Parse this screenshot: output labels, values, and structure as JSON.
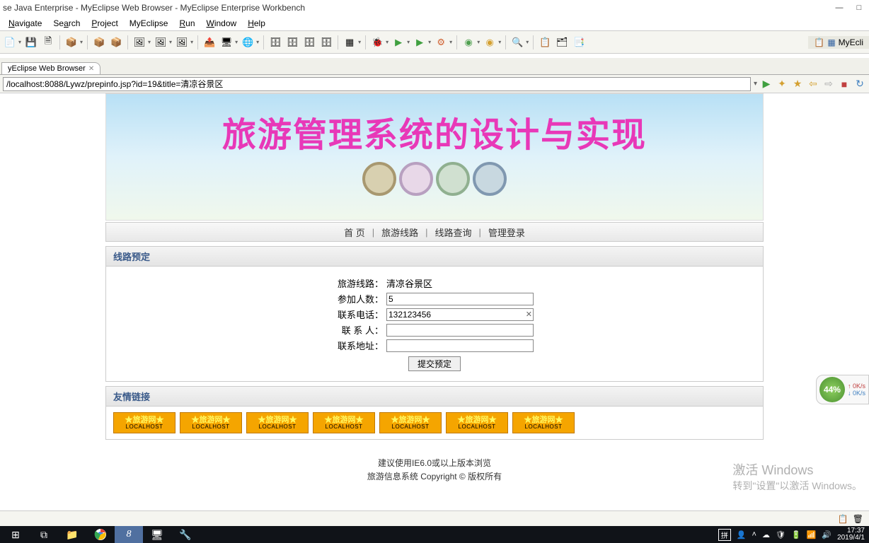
{
  "window": {
    "title": "se Java Enterprise - MyEclipse Web Browser - MyEclipse Enterprise Workbench"
  },
  "menu": {
    "navigate": "Navigate",
    "search": "Search",
    "project": "Project",
    "myeclipse": "MyEclipse",
    "run": "Run",
    "window": "Window",
    "help": "Help"
  },
  "perspective": {
    "label": "MyEcli"
  },
  "tab": {
    "label": "yEclipse Web Browser"
  },
  "url": {
    "value": "/localhost:8088/Lywz/prepinfo.jsp?id=19&title=清凉谷景区"
  },
  "banner": {
    "title": "旅游管理系统的设计与实现"
  },
  "nav": {
    "home": "首 页",
    "routes": "旅游线路",
    "query": "线路查询",
    "admin": "管理登录"
  },
  "form": {
    "section_title": "线路预定",
    "route_label": "旅游线路：",
    "route_value": "清凉谷景区",
    "people_label": "参加人数：",
    "people_value": "5",
    "phone_label": "联系电话：",
    "phone_value": "132123456",
    "contact_label": "联 系 人：",
    "contact_value": "",
    "address_label": "联系地址：",
    "address_value": "",
    "submit": "提交预定"
  },
  "links": {
    "section_title": "友情链接",
    "badge_line1": "★旅游网★",
    "badge_line2": "LOCALHOST"
  },
  "footer": {
    "line1": "建议使用IE6.0或以上版本浏览",
    "line2": "旅游信息系统 Copyright © 版权所有"
  },
  "watermark": {
    "line1": "激活 Windows",
    "line2": "转到\"设置\"以激活 Windows。"
  },
  "netmon": {
    "pct": "44%",
    "up": "0K/s",
    "down": "0K/s"
  },
  "taskbar": {
    "time": "17:37",
    "date": "2019/4/1"
  }
}
